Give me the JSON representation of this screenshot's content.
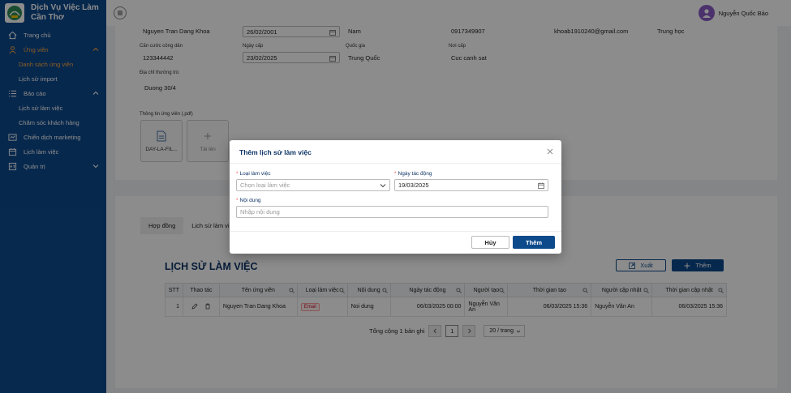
{
  "app": {
    "name_line1": "Dịch Vụ Việc Làm",
    "name_line2": "Cần Thơ"
  },
  "sidebar": {
    "items": [
      {
        "label": "Trang chủ",
        "icon": "home-icon"
      },
      {
        "label": "Ứng viên",
        "icon": "user-group-icon",
        "open": true,
        "children": [
          "Danh sách ứng viên",
          "Lịch sử import"
        ]
      },
      {
        "label": "Báo cáo",
        "icon": "list-icon",
        "open": true,
        "children": [
          "Lịch sử làm việc",
          "Chăm sóc khách hàng"
        ]
      },
      {
        "label": "Chiến dịch marketing",
        "icon": "campaign-icon"
      },
      {
        "label": "Lịch làm việc",
        "icon": "calendar-icon"
      },
      {
        "label": "Quản trị",
        "icon": "admin-icon"
      }
    ]
  },
  "header": {
    "user_name": "Nguyễn Quốc Bảo"
  },
  "profile": {
    "full_name": "Nguyen Tran Dang Khoa",
    "birth_date": "26/02/2001",
    "gender": "Nam",
    "phone": "0917349907",
    "email": "khoab1910240@gmail.com",
    "education": "Trung học",
    "id_label": "Căn cước công dân",
    "id_value": "123344442",
    "issue_date_label": "Ngày cấp",
    "issue_date": "23/02/2025",
    "nationality_label": "Quốc gia",
    "nationality": "Trung Quốc",
    "issue_place_label": "Nơi cấp",
    "issue_place": "Cuc canh sat",
    "address_label": "Địa chỉ thường trú",
    "address": "Duong 30/4",
    "cv_label": "Thông tin ứng viên (.pdf)",
    "cv_file": "DAY-LA-FIL...",
    "upload_label": "Tải lên"
  },
  "history": {
    "tabs": [
      "Hợp đồng",
      "Lịch sử làm việc"
    ],
    "title": "LỊCH SỬ LÀM VIỆC",
    "export_label": "Xuất",
    "add_label": "Thêm",
    "columns": [
      "STT",
      "Thao tác",
      "Tên ứng viên",
      "Loại làm việc",
      "Nội dung",
      "Ngày tác động",
      "Người tạo",
      "Thời gian tạo",
      "Người cập nhật",
      "Thời gian cập nhật"
    ],
    "rows": [
      {
        "stt": "1",
        "candidate": "Nguyen Tran Dang Khoa",
        "type": "Email",
        "content": "Noi dung",
        "action_date": "06/03/2025 00:00",
        "creator": "Nguyễn Văn An",
        "created_at": "06/03/2025 15:36",
        "updater": "Nguyễn Văn An",
        "updated_at": "06/03/2025 15:36"
      }
    ],
    "total": "Tổng cộng 1 bản ghi",
    "page": "1",
    "page_size": "20 / trang"
  },
  "modal": {
    "title": "Thêm lịch sử làm việc",
    "type_label": "Loại làm việc",
    "type_placeholder": "Chọn loại làm việc",
    "date_label": "Ngày tác động",
    "date_value": "19/03/2025",
    "content_label": "Nội dung",
    "content_placeholder": "Nhập nội dung",
    "cancel_label": "Hủy",
    "submit_label": "Thêm"
  }
}
